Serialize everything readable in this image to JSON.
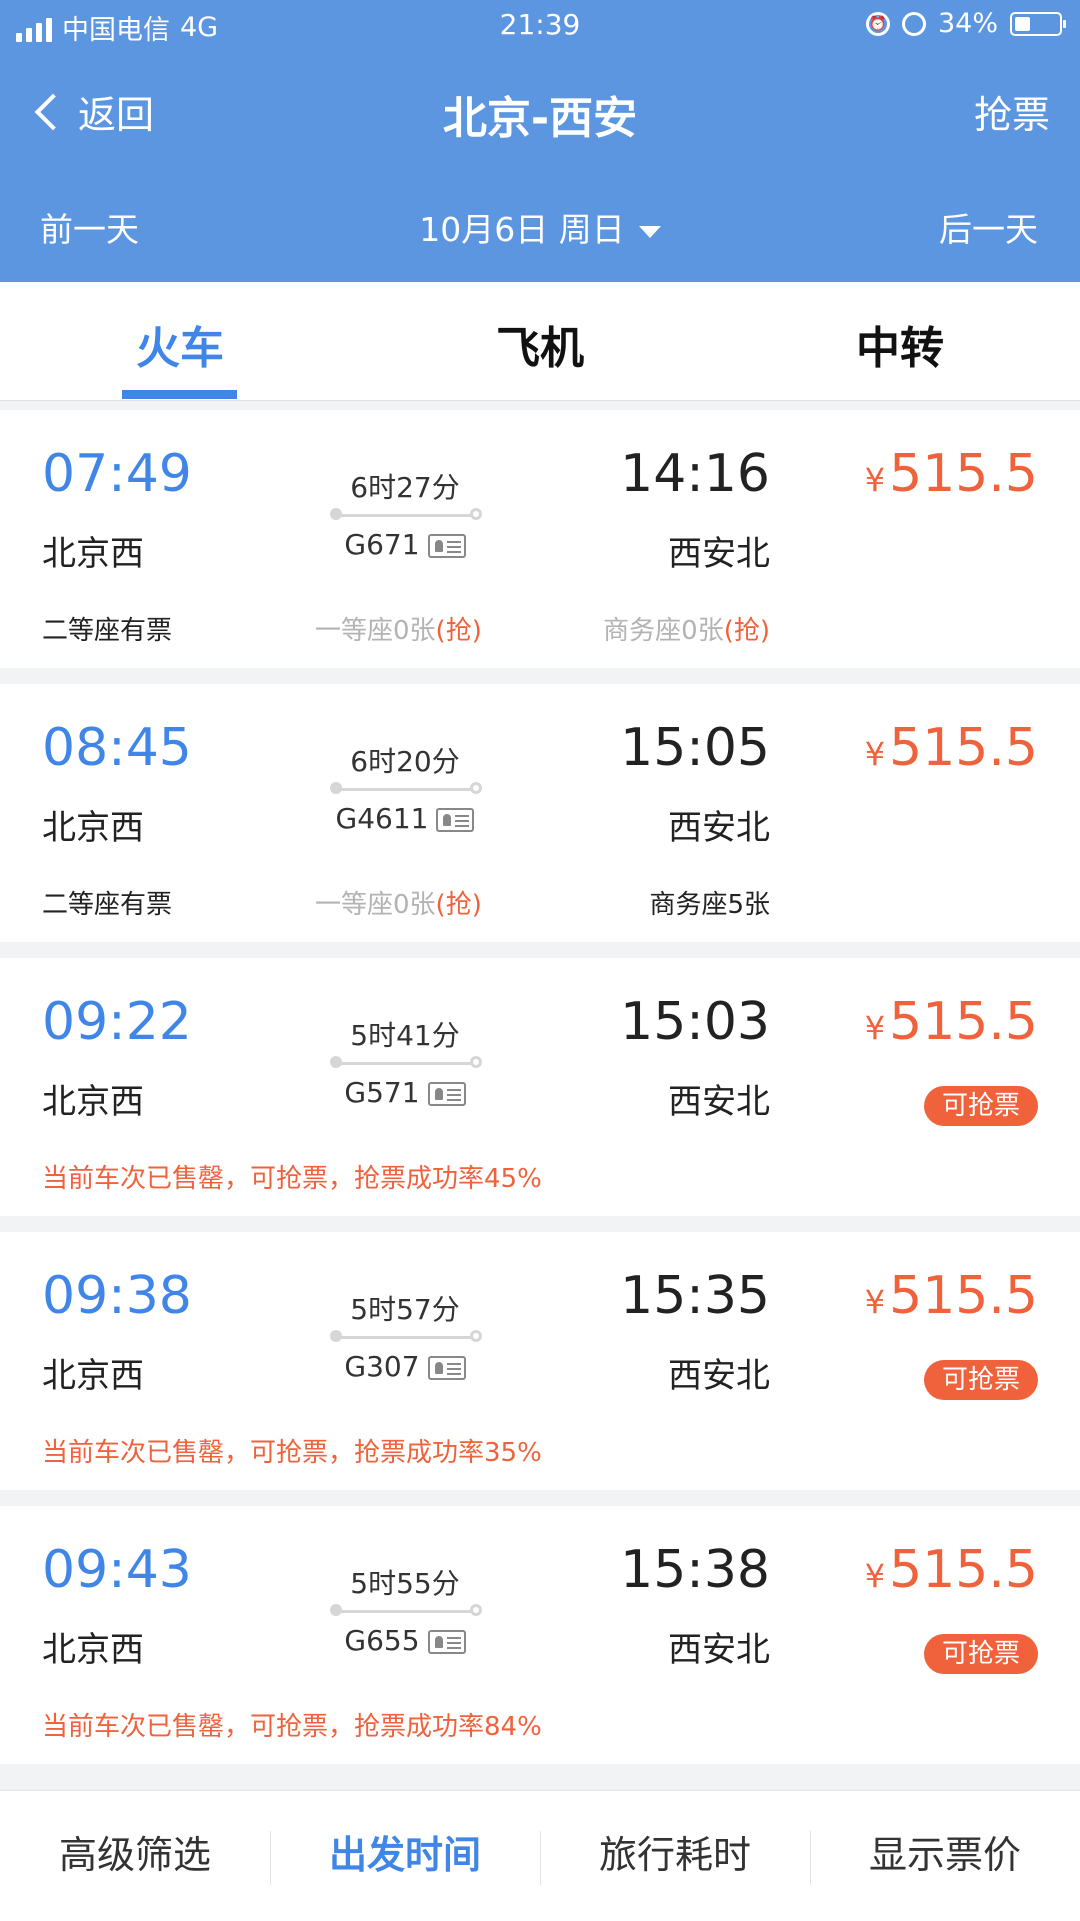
{
  "status_bar": {
    "carrier": "中国电信",
    "network": "4G",
    "time": "21:39",
    "battery": "34%",
    "battery_level": 0.34
  },
  "header": {
    "back_label": "返回",
    "title": "北京-西安",
    "grab_label": "抢票",
    "prev_day": "前一天",
    "date": "10月6日 周日",
    "next_day": "后一天"
  },
  "tabs": [
    {
      "label": "火车",
      "active": true
    },
    {
      "label": "飞机",
      "active": false
    },
    {
      "label": "中转",
      "active": false
    }
  ],
  "trains": [
    {
      "depart_time": "07:49",
      "depart_station": "北京西",
      "duration": "6时27分",
      "train_no": "G671",
      "arrive_time": "14:16",
      "arrive_station": "西安北",
      "yen": "¥",
      "price": "515.5",
      "seat1": "二等座有票",
      "seat2": "一等座0张",
      "seat2_grab": "(抢)",
      "seat3": "商务座0张",
      "seat3_grab": "(抢)"
    },
    {
      "depart_time": "08:45",
      "depart_station": "北京西",
      "duration": "6时20分",
      "train_no": "G4611",
      "arrive_time": "15:05",
      "arrive_station": "西安北",
      "yen": "¥",
      "price": "515.5",
      "seat1": "二等座有票",
      "seat2": "一等座0张",
      "seat2_grab": "(抢)",
      "seat3": "商务座5张"
    },
    {
      "depart_time": "09:22",
      "depart_station": "北京西",
      "duration": "5时41分",
      "train_no": "G571",
      "arrive_time": "15:03",
      "arrive_station": "西安北",
      "yen": "¥",
      "price": "515.5",
      "badge": "可抢票",
      "notice": "当前车次已售罄，可抢票，抢票成功率45%"
    },
    {
      "depart_time": "09:38",
      "depart_station": "北京西",
      "duration": "5时57分",
      "train_no": "G307",
      "arrive_time": "15:35",
      "arrive_station": "西安北",
      "yen": "¥",
      "price": "515.5",
      "badge": "可抢票",
      "notice": "当前车次已售罄，可抢票，抢票成功率35%"
    },
    {
      "depart_time": "09:43",
      "depart_station": "北京西",
      "duration": "5时55分",
      "train_no": "G655",
      "arrive_time": "15:38",
      "arrive_station": "西安北",
      "yen": "¥",
      "price": "515.5",
      "badge": "可抢票",
      "notice": "当前车次已售罄，可抢票，抢票成功率84%"
    }
  ],
  "bottom_bar": [
    {
      "label": "高级筛选",
      "active": false
    },
    {
      "label": "出发时间",
      "active": true
    },
    {
      "label": "旅行耗时",
      "active": false
    },
    {
      "label": "显示票价",
      "active": false
    }
  ],
  "colors": {
    "header_bg": "#5c95e0",
    "accent_blue": "#3f86e8",
    "price_red": "#f0623c"
  }
}
